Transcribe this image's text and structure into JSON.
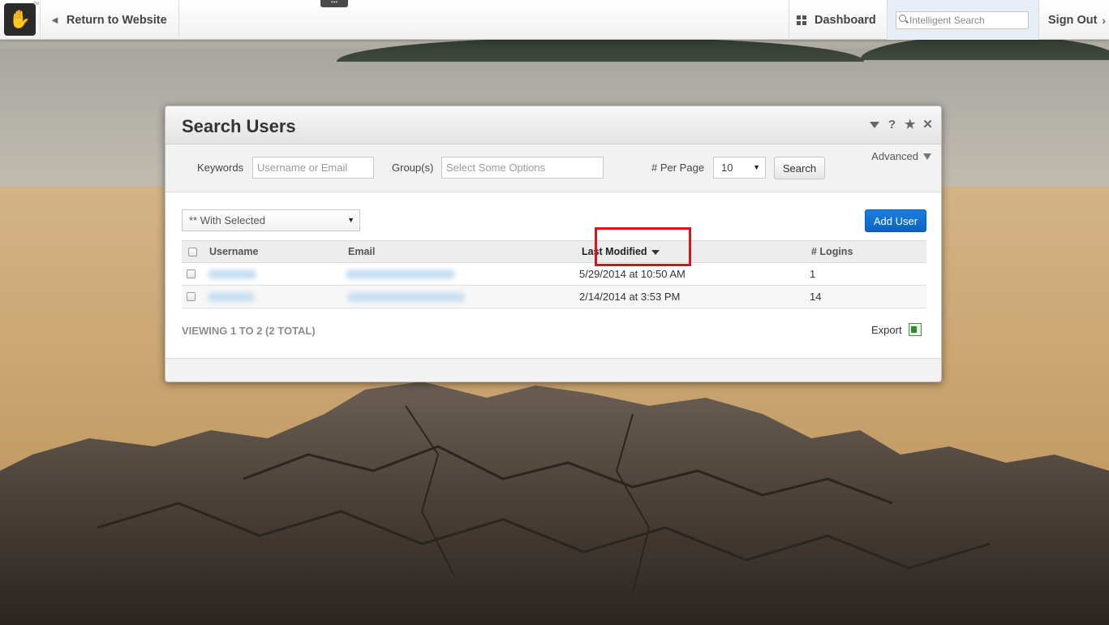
{
  "toolbar": {
    "return_label": "Return to Website",
    "dashboard_label": "Dashboard",
    "search_placeholder": "Intelligent Search",
    "signout_label": "Sign Out",
    "logo_glyph": "✋",
    "logo_tm": "TM",
    "handle_glyph": "•••"
  },
  "dialog": {
    "title": "Search Users",
    "controls": {
      "help_glyph": "?",
      "favorite_glyph": "★",
      "close_glyph": "✕"
    },
    "filters": {
      "keywords_label": "Keywords",
      "keywords_placeholder": "Username or Email",
      "groups_label": "Group(s)",
      "groups_placeholder": "Select Some Options",
      "per_page_label": "# Per Page",
      "per_page_value": "10",
      "search_button": "Search",
      "advanced_label": "Advanced"
    },
    "with_selected": "** With Selected",
    "add_user_button": "Add User",
    "table": {
      "headers": {
        "username": "Username",
        "email": "Email",
        "last_modified": "Last Modified",
        "logins": "# Logins"
      },
      "sorted_by": "last_modified",
      "rows": [
        {
          "last_modified": "5/29/2014 at 10:50 AM",
          "logins": "1"
        },
        {
          "last_modified": "2/14/2014 at 3:53 PM",
          "logins": "14"
        }
      ]
    },
    "viewing_text": "VIEWING 1 TO 2 (2 TOTAL)",
    "export_label": "Export"
  },
  "colors": {
    "accent_blue": "#0a63c4",
    "highlight_red": "#e0101a"
  },
  "icons": {
    "return": "arrow-left-icon",
    "dashboard": "grid-icon",
    "search": "magnifier-icon",
    "signout": "chevron-right-icon",
    "export": "excel-icon"
  }
}
